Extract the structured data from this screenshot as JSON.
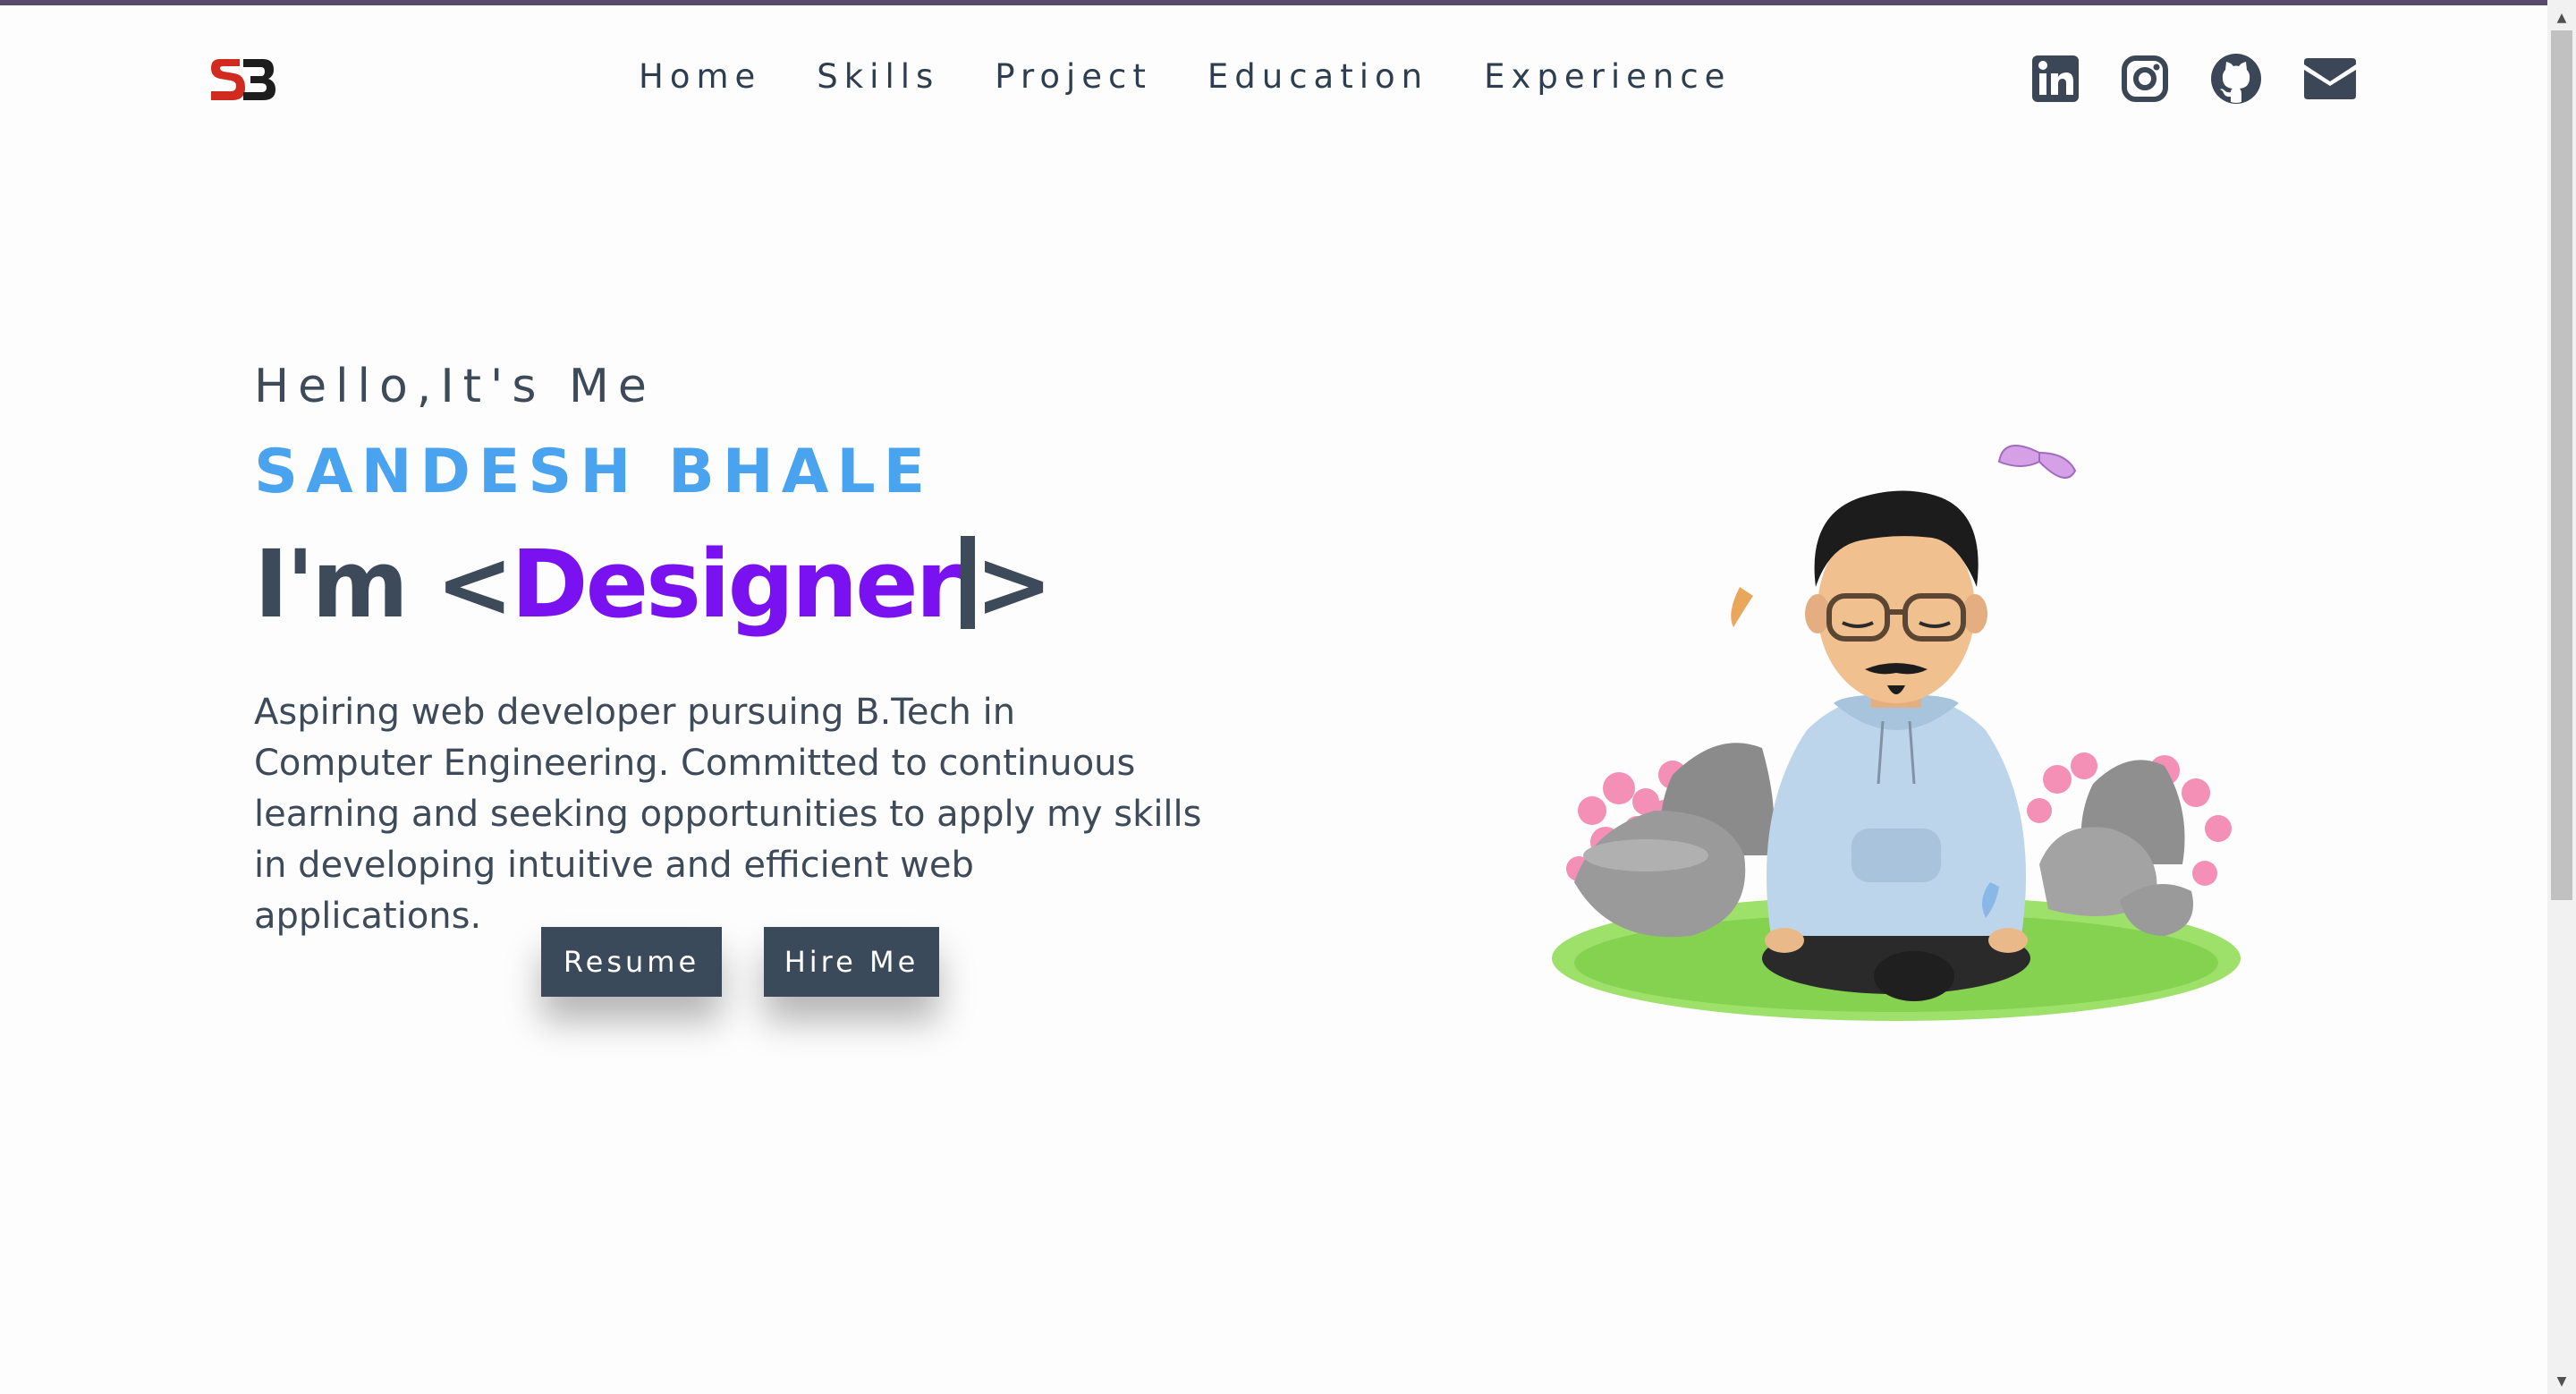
{
  "header": {
    "logo_text": "SB",
    "nav": [
      "Home",
      "Skills",
      "Project",
      "Education",
      "Experience"
    ],
    "socials": [
      "linkedin-icon",
      "instagram-icon",
      "github-icon",
      "mail-icon"
    ]
  },
  "hero": {
    "greeting": "Hello,It's Me",
    "name": "SANDESH BHALE",
    "role_prefix": "I'm ",
    "role_open": "<",
    "role": "Designer",
    "role_close": ">",
    "description": "Aspiring web developer pursuing B.Tech in Computer Engineering. Committed to continuous learning and seeking opportunities to apply my skills in developing intuitive and efficient web applications.",
    "buttons": {
      "resume": "Resume",
      "hire": "Hire Me"
    }
  },
  "colors": {
    "name_accent": "#4aa3ee",
    "role_accent": "#7a11f0",
    "button_bg": "#3b4a5a",
    "text": "#3d4a5a"
  }
}
